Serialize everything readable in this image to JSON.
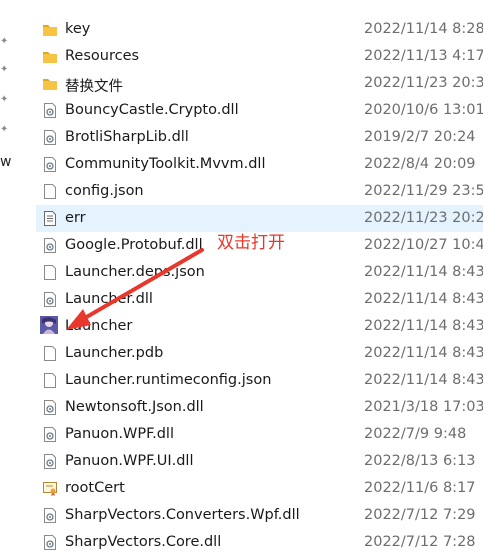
{
  "left_strip": {
    "partial_text": "w"
  },
  "files": [
    {
      "name": "key",
      "date": "2022/11/14 8:28",
      "icon": "folder-icon",
      "selected": false
    },
    {
      "name": "Resources",
      "date": "2022/11/13 4:17",
      "icon": "folder-icon",
      "selected": false
    },
    {
      "name": "替换文件",
      "date": "2022/11/23 20:3",
      "icon": "folder-icon",
      "selected": false
    },
    {
      "name": "BouncyCastle.Crypto.dll",
      "date": "2020/10/6 13:01",
      "icon": "dll-icon",
      "selected": false
    },
    {
      "name": "BrotliSharpLib.dll",
      "date": "2019/2/7 20:24",
      "icon": "dll-icon",
      "selected": false
    },
    {
      "name": "CommunityToolkit.Mvvm.dll",
      "date": "2022/8/4 20:09",
      "icon": "dll-icon",
      "selected": false
    },
    {
      "name": "config.json",
      "date": "2022/11/29 23:5",
      "icon": "file-icon",
      "selected": false
    },
    {
      "name": "err",
      "date": "2022/11/23 20:2",
      "icon": "text-file-icon",
      "selected": true
    },
    {
      "name": "Google.Protobuf.dll",
      "date": "2022/10/27 10:4",
      "icon": "dll-icon",
      "selected": false
    },
    {
      "name": "Launcher.deps.json",
      "date": "2022/11/14 8:43",
      "icon": "file-icon",
      "selected": false
    },
    {
      "name": "Launcher.dll",
      "date": "2022/11/14 8:43",
      "icon": "dll-icon",
      "selected": false
    },
    {
      "name": "Launcher",
      "date": "2022/11/14 8:43",
      "icon": "app-icon",
      "selected": false
    },
    {
      "name": "Launcher.pdb",
      "date": "2022/11/14 8:43",
      "icon": "file-icon",
      "selected": false
    },
    {
      "name": "Launcher.runtimeconfig.json",
      "date": "2022/11/14 8:43",
      "icon": "file-icon",
      "selected": false
    },
    {
      "name": "Newtonsoft.Json.dll",
      "date": "2021/3/18 17:03",
      "icon": "dll-icon",
      "selected": false
    },
    {
      "name": "Panuon.WPF.dll",
      "date": "2022/7/9 9:48",
      "icon": "dll-icon",
      "selected": false
    },
    {
      "name": "Panuon.WPF.UI.dll",
      "date": "2022/8/13 6:13",
      "icon": "dll-icon",
      "selected": false
    },
    {
      "name": "rootCert",
      "date": "2022/11/6 8:17",
      "icon": "certificate-icon",
      "selected": false
    },
    {
      "name": "SharpVectors.Converters.Wpf.dll",
      "date": "2022/7/12 7:29",
      "icon": "dll-icon",
      "selected": false
    },
    {
      "name": "SharpVectors.Core.dll",
      "date": "2022/7/12 7:28",
      "icon": "dll-icon",
      "selected": false
    }
  ],
  "annotation": {
    "text": "双击打开",
    "color": "#e8372b"
  },
  "colors": {
    "folder": "#f6c342",
    "selection": "#e5f3ff",
    "date_text": "#6d6d6d"
  }
}
